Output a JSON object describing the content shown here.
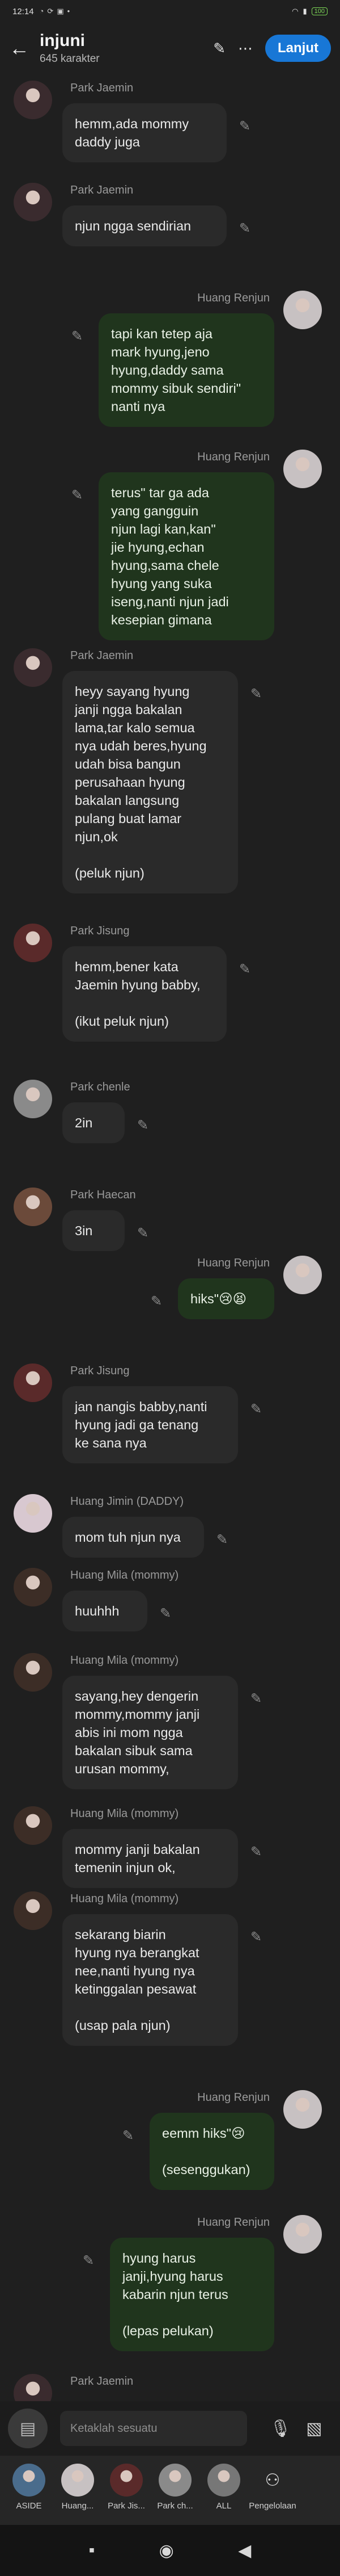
{
  "status": {
    "time": "12:14",
    "icons": [
      "notification-icon",
      "sync-icon",
      "image-icon",
      "dot-icon"
    ],
    "battery": "100"
  },
  "header": {
    "title": "injuni",
    "subtitle": "645 karakter",
    "next_label": "Lanjut"
  },
  "colors": {
    "in_bubble": "#2a2a2a",
    "out_bubble": "#20351d",
    "accent": "#1877d6"
  },
  "messages": [
    {
      "side": "in",
      "name": "Park Jaemin",
      "text": "hemm,ada mommy\ndaddy juga",
      "avatar": "#3a2b2e"
    },
    {
      "side": "in",
      "name": "Park Jaemin",
      "text": "njun ngga sendirian",
      "avatar": "#3a2b2e"
    },
    {
      "side": "out",
      "name": "Huang Renjun",
      "text": "tapi kan tetep aja\nmark hyung,jeno\nhyung,daddy sama\nmommy sibuk sendiri\"\nnanti nya",
      "avatar": "#c7c1c2"
    },
    {
      "side": "out",
      "name": "Huang Renjun",
      "text": "terus\" tar ga ada\nyang gangguin\nnjun lagi kan,kan\"\njie hyung,echan\nhyung,sama chele\nhyung yang suka\niseng,nanti njun jadi\nkesepian gimana",
      "avatar": "#c7c1c2"
    },
    {
      "side": "in",
      "name": "Park Jaemin",
      "text": "heyy sayang hyung\njanji ngga bakalan\nlama,tar kalo semua\nnya udah beres,hyung\nudah bisa bangun\nperusahaan hyung\nbakalan langsung\npulang buat lamar\nnjun,ok\n\n(peluk njun)",
      "avatar": "#3a2b2e"
    },
    {
      "side": "in",
      "name": "Park Jisung",
      "text": "hemm,bener kata\nJaemin hyung babby,\n\n(ikut peluk njun)",
      "avatar": "#5a2a2a"
    },
    {
      "side": "in",
      "name": "Park chenle",
      "text": "2in",
      "avatar": "#8a8a8a"
    },
    {
      "side": "in",
      "name": "Park Haecan",
      "text": "3in",
      "avatar": "#6b4a3a"
    },
    {
      "side": "out",
      "name": "Huang Renjun",
      "text": "hiks\"😢😫",
      "avatar": "#c7c1c2"
    },
    {
      "side": "in",
      "name": "Park Jisung",
      "text": "jan nangis babby,nanti\nhyung jadi ga tenang\nke sana nya",
      "avatar": "#5a2a2a"
    },
    {
      "side": "in",
      "name": "Huang Jimin (DADDY)",
      "text": "mom tuh njun nya",
      "avatar": "#d8c8d0"
    },
    {
      "side": "in",
      "name": "Huang Mila (mommy)",
      "text": "huuhhh",
      "avatar": "#3c2d26"
    },
    {
      "side": "in",
      "name": "Huang Mila (mommy)",
      "text": "sayang,hey dengerin\nmommy,mommy janji\nabis ini mom ngga\nbakalan sibuk sama\nurusan mommy,",
      "avatar": "#3c2d26"
    },
    {
      "side": "in",
      "name": "Huang Mila (mommy)",
      "text": "mommy janji bakalan\ntemenin injun ok,",
      "avatar": "#3c2d26"
    },
    {
      "side": "in",
      "name": "Huang Mila (mommy)",
      "text": "sekarang biarin\nhyung nya berangkat\nnee,nanti hyung nya\nketinggalan pesawat\n\n(usap pala njun)",
      "avatar": "#3c2d26"
    },
    {
      "side": "out",
      "name": "Huang Renjun",
      "text": "eemm hiks\"😢\n\n(sesenggukan)",
      "avatar": "#c7c1c2"
    },
    {
      "side": "out",
      "name": "Huang Renjun",
      "text": "hyung harus\njanji,hyung harus\nkabarin njun terus\n\n(lepas pelukan)",
      "avatar": "#c7c1c2"
    },
    {
      "side": "in",
      "name": "Park Jaemin",
      "text": "",
      "avatar": "#3a2b2e"
    }
  ],
  "input": {
    "placeholder": "Ketaklah sesuatu"
  },
  "characters": [
    {
      "label": "ASIDE",
      "color": "#4a6c8c"
    },
    {
      "label": "Huang...",
      "color": "#c7c1c2"
    },
    {
      "label": "Park Jis...",
      "color": "#5a2a2a"
    },
    {
      "label": "Park ch...",
      "color": "#8a8a8a"
    },
    {
      "label": "ALL",
      "color": "#777"
    },
    {
      "label": "Pengelolaan",
      "color": ""
    }
  ]
}
